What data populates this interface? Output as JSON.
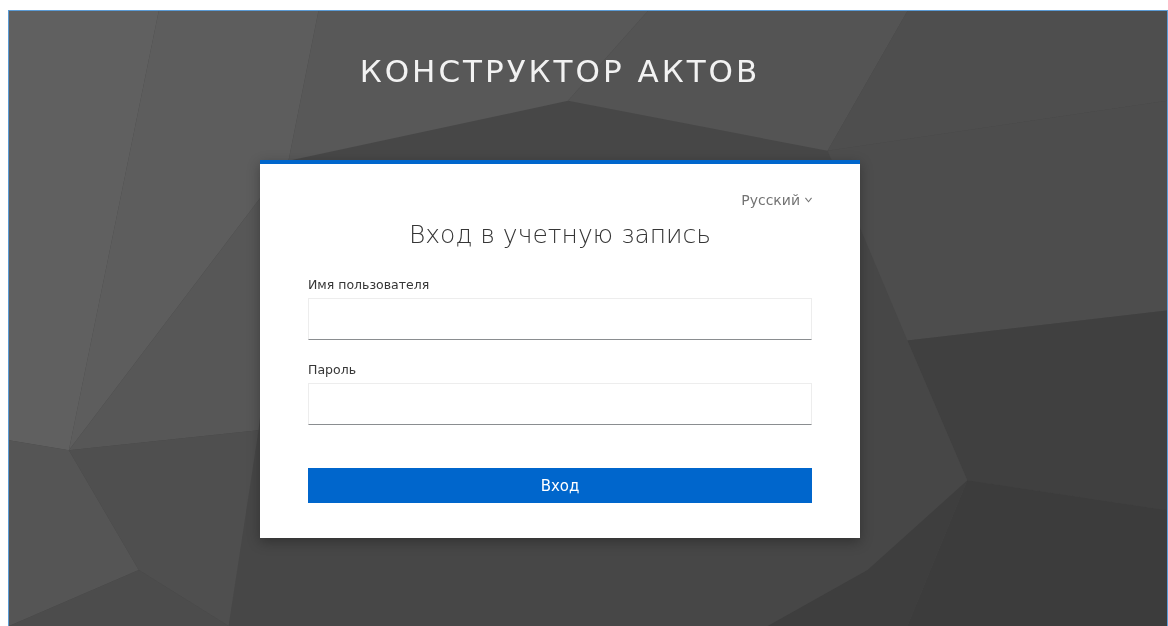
{
  "app_title": "КОНСТРУКТОР АКТОВ",
  "login_card": {
    "language": "Русский",
    "heading": "Вход в учетную запись",
    "fields": [
      {
        "label": "Имя пользователя"
      },
      {
        "label": "Пароль"
      }
    ],
    "submit_button": "Вход"
  }
}
